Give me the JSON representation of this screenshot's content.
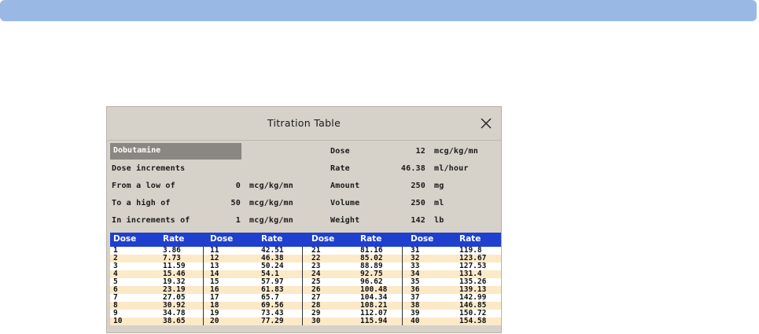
{
  "dialog": {
    "title": "Titration Table",
    "drug": "Dobutamine",
    "left_fields": [
      {
        "label": "Dose increments",
        "value": "",
        "unit": ""
      },
      {
        "label": "From a low of",
        "value": "0",
        "unit": "mcg/kg/mn"
      },
      {
        "label": "To a high of",
        "value": "50",
        "unit": "mcg/kg/mn"
      },
      {
        "label": "In increments of",
        "value": "1",
        "unit": "mcg/kg/mn"
      }
    ],
    "right_fields": [
      {
        "label": "Dose",
        "value": "12",
        "unit": "mcg/kg/mn"
      },
      {
        "label": "Rate",
        "value": "46.38",
        "unit": "ml/hour"
      },
      {
        "label": "Amount",
        "value": "250",
        "unit": "mg"
      },
      {
        "label": "Volume",
        "value": "250",
        "unit": "ml"
      },
      {
        "label": "Weight",
        "value": "142",
        "unit": "lb"
      }
    ]
  },
  "table": {
    "headers": [
      "Dose",
      "Rate",
      "Dose",
      "Rate",
      "Dose",
      "Rate",
      "Dose",
      "Rate"
    ],
    "rows": [
      [
        "1",
        "3.86",
        "11",
        "42.51",
        "21",
        "81.16",
        "31",
        "119.8"
      ],
      [
        "2",
        "7.73",
        "12",
        "46.38",
        "22",
        "85.02",
        "32",
        "123.67"
      ],
      [
        "3",
        "11.59",
        "13",
        "50.24",
        "23",
        "88.89",
        "33",
        "127.53"
      ],
      [
        "4",
        "15.46",
        "14",
        "54.1",
        "24",
        "92.75",
        "34",
        "131.4"
      ],
      [
        "5",
        "19.32",
        "15",
        "57.97",
        "25",
        "96.62",
        "35",
        "135.26"
      ],
      [
        "6",
        "23.19",
        "16",
        "61.83",
        "26",
        "100.48",
        "36",
        "139.13"
      ],
      [
        "7",
        "27.05",
        "17",
        "65.7",
        "27",
        "104.34",
        "37",
        "142.99"
      ],
      [
        "8",
        "30.92",
        "18",
        "69.56",
        "28",
        "108.21",
        "38",
        "146.85"
      ],
      [
        "9",
        "34.78",
        "19",
        "73.43",
        "29",
        "112.07",
        "39",
        "150.72"
      ],
      [
        "10",
        "38.65",
        "20",
        "77.29",
        "30",
        "115.94",
        "40",
        "154.58"
      ]
    ]
  },
  "colors": {
    "top_bar": "#9ab8e4",
    "header_bg": "#1f3fcf",
    "row_alt": "#fbe9c7",
    "dialog_bg": "#d6d1c9"
  }
}
